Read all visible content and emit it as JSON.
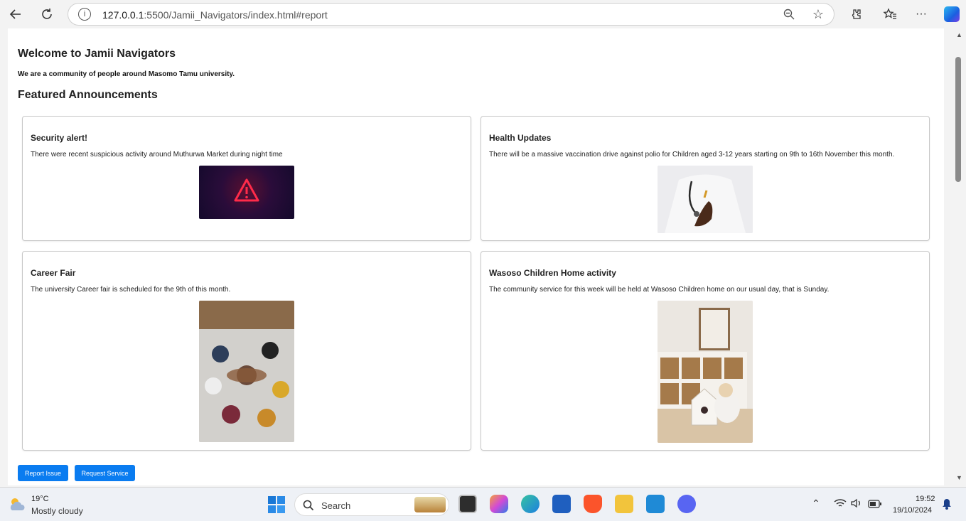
{
  "browser": {
    "url_host": "127.0.0.1",
    "url_rest": ":5500/Jamii_Navigators/index.html#report"
  },
  "page": {
    "title": "Welcome to Jamii Navigators",
    "intro": "We are a community of people around Masomo Tamu university.",
    "featured_heading": "Featured Announcements",
    "announcements": [
      {
        "title": "Security alert!",
        "text": "There were recent suspicious activity around Muthurwa Market during night time",
        "image": "warning-alert-image"
      },
      {
        "title": "Health Updates",
        "text": "There will be a massive vaccination drive against polio for Children aged 3-12 years starting on 9th to 16th November this month.",
        "image": "doctor-vaccine-image"
      },
      {
        "title": "Career Fair",
        "text": "The university Career fair is scheduled for the 9th of this month.",
        "image": "team-hands-image"
      },
      {
        "title": "Wasoso Children Home activity",
        "text": "The community service for this week will be held at Wasoso Children home on our usual day, that is Sunday.",
        "image": "child-playroom-image"
      }
    ],
    "buttons": {
      "report": "Report Issue",
      "request": "Request Service"
    }
  },
  "taskbar": {
    "weather_temp": "19°C",
    "weather_desc": "Mostly cloudy",
    "search_label": "Search",
    "time": "19:52",
    "date": "19/10/2024"
  },
  "colors": {
    "accent": "#0a7cf0"
  }
}
